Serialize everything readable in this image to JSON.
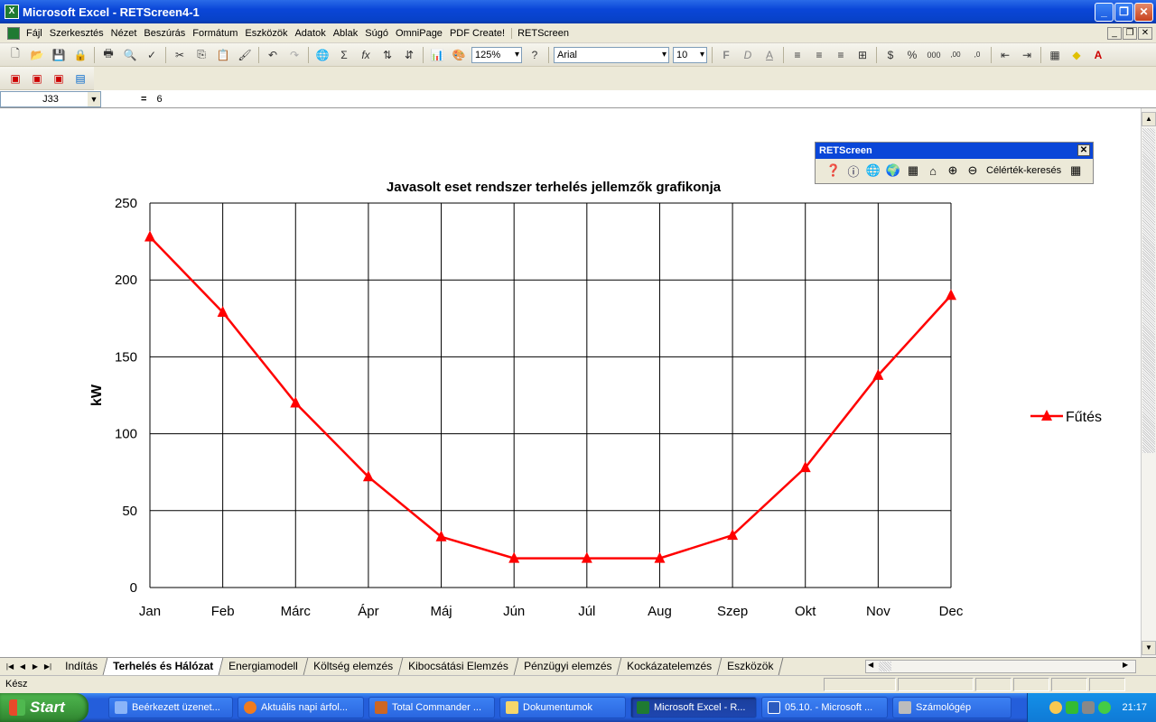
{
  "window": {
    "title": "Microsoft Excel - RETScreen4-1"
  },
  "menu": [
    "Fájl",
    "Szerkesztés",
    "Nézet",
    "Beszúrás",
    "Formátum",
    "Eszközök",
    "Adatok",
    "Ablak",
    "Súgó",
    "OmniPage",
    "PDF Create!",
    "RETScreen"
  ],
  "toolbar": {
    "zoom": "125%",
    "font": "Arial",
    "size": "10"
  },
  "formula": {
    "cell": "J33",
    "eq": "=",
    "value": "6"
  },
  "panel": {
    "title": "RETScreen",
    "goal_seek": "Célérték-keresés"
  },
  "chart_data": {
    "type": "line",
    "title": "Javasolt eset rendszer terhelés jellemzők grafikonja",
    "ylabel": "kW",
    "xlabel": "",
    "ylim": [
      0,
      250
    ],
    "yticks": [
      0,
      50,
      100,
      150,
      200,
      250
    ],
    "categories": [
      "Jan",
      "Feb",
      "Márc",
      "Ápr",
      "Máj",
      "Jún",
      "Júl",
      "Aug",
      "Szep",
      "Okt",
      "Nov",
      "Dec"
    ],
    "series": [
      {
        "name": "Fűtés",
        "color": "#ff0000",
        "marker": "triangle",
        "values": [
          228,
          179,
          120,
          72,
          33,
          19,
          19,
          19,
          34,
          78,
          138,
          190
        ]
      }
    ],
    "grid": true,
    "legend": "right"
  },
  "tabs": [
    "Indítás",
    "Terhelés és Hálózat",
    "Energiamodell",
    "Költség elemzés",
    "Kibocsátási Elemzés",
    "Pénzügyi elemzés",
    "Kockázatelemzés",
    "Eszközök"
  ],
  "active_tab": "Terhelés és Hálózat",
  "status": "Kész",
  "taskbar": {
    "start": "Start",
    "tasks": [
      "Beérkezett üzenet...",
      "Aktuális napi árfol...",
      "Total Commander ...",
      "Dokumentumok",
      "Microsoft Excel - R...",
      "05.10. - Microsoft ...",
      "Számológép"
    ],
    "clock": "21:17"
  }
}
